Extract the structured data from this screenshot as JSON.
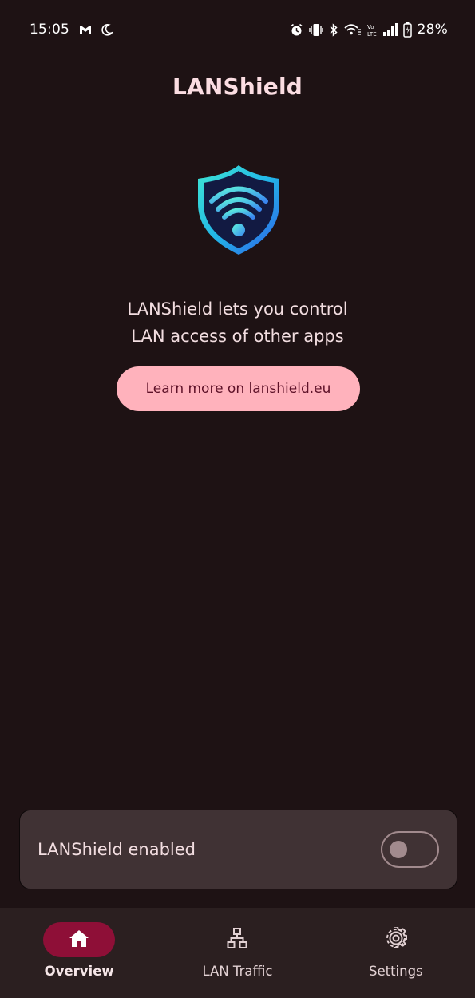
{
  "status_bar": {
    "time": "15:05",
    "battery_percent": "28%",
    "left_icons": [
      "gmail-icon",
      "do-not-disturb-moon-icon"
    ],
    "right_icons": [
      "alarm-icon",
      "vibrate-icon",
      "bluetooth-icon",
      "wifi-icon",
      "volte-icon",
      "cell-signal-icon",
      "battery-icon"
    ]
  },
  "app": {
    "title": "LANShield",
    "logo_icon": "shield-wifi-icon"
  },
  "main": {
    "tagline_line1": "LANShield lets you control",
    "tagline_line2": "LAN access of other apps",
    "learn_more_label": "Learn more on lanshield.eu"
  },
  "enable_card": {
    "label": "LANShield enabled",
    "enabled": false
  },
  "bottom_nav": {
    "items": [
      {
        "label": "Overview",
        "icon": "home-icon",
        "active": true
      },
      {
        "label": "LAN Traffic",
        "icon": "network-icon",
        "active": false
      },
      {
        "label": "Settings",
        "icon": "gear-icon",
        "active": false
      }
    ]
  },
  "colors": {
    "background": "#1e1214",
    "accent_pill": "#8e0f37",
    "button_bg": "#ffb2bc",
    "button_text": "#5d1128",
    "card_bg": "#403234"
  }
}
